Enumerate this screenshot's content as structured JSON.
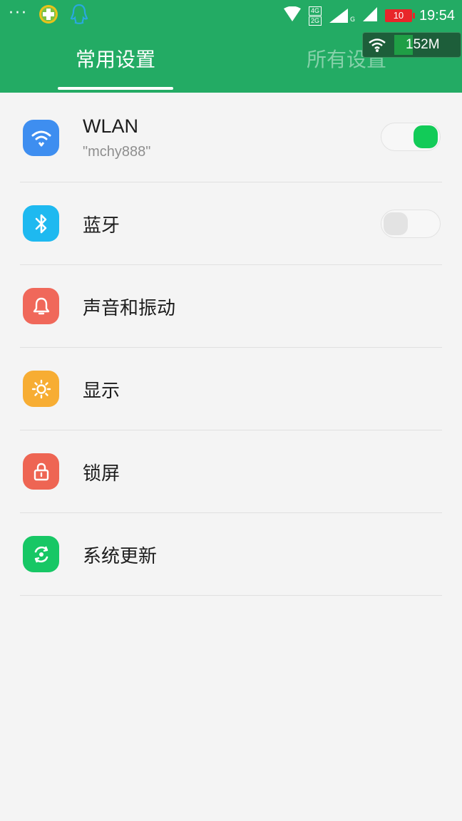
{
  "status_bar": {
    "time": "19:54",
    "battery_level": "10",
    "network_labels": [
      "4G",
      "2G"
    ],
    "signal_suffix": "G",
    "floating_speed": "152M",
    "icons": [
      "more-dots-icon",
      "security-app-icon",
      "qq-penguin-icon",
      "wifi-icon",
      "network-type-icon",
      "cell-signal-icon",
      "battery-icon"
    ]
  },
  "tabs": [
    {
      "label": "常用设置",
      "active": true
    },
    {
      "label": "所有设置",
      "active": false
    }
  ],
  "settings": [
    {
      "label": "WLAN",
      "subtitle": "\"mchy888\"",
      "icon": "wifi-icon",
      "color": "#3e8ef0",
      "toggle": "on"
    },
    {
      "label": "蓝牙",
      "icon": "bluetooth-icon",
      "color": "#1eb9f0",
      "toggle": "off"
    },
    {
      "label": "声音和振动",
      "icon": "bell-icon",
      "color": "#f0685a"
    },
    {
      "label": "显示",
      "icon": "brightness-icon",
      "color": "#f7ad33"
    },
    {
      "label": "锁屏",
      "icon": "lock-icon",
      "color": "#ee6553"
    },
    {
      "label": "系统更新",
      "icon": "update-icon",
      "color": "#17c765"
    }
  ],
  "colors": {
    "header": "#23ab64",
    "toggle_on": "#12cb58",
    "background": "#f4f4f4"
  }
}
